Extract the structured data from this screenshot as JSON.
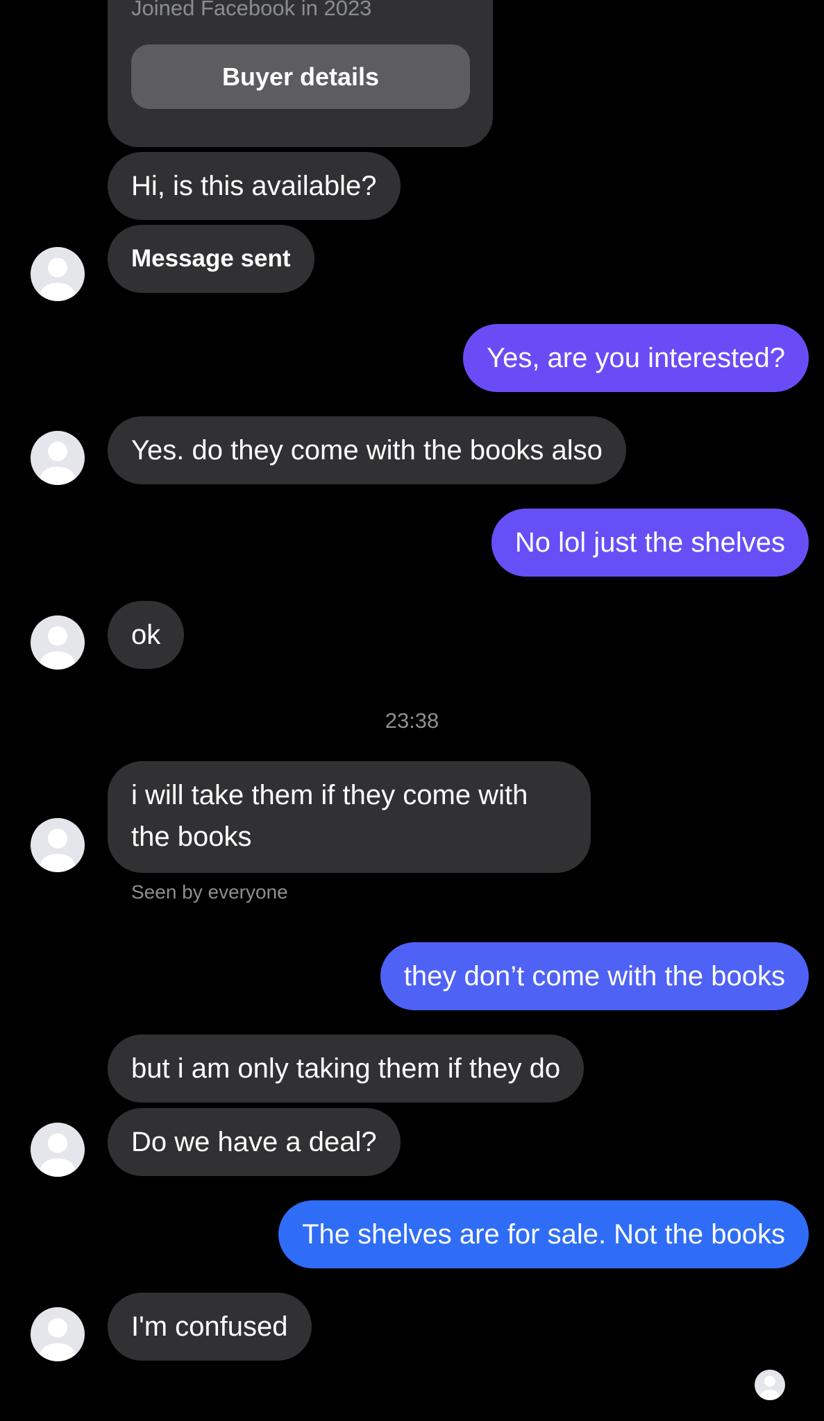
{
  "colors": {
    "background": "#000000",
    "incoming_bubble": "#313133",
    "outgoing_purple": "#6a4cf7",
    "outgoing_indigo": "#5a5ef5",
    "outgoing_blue": "#2f6df6"
  },
  "buyer_card": {
    "joined_text": "Joined Facebook in 2023",
    "button_label": "Buyer details"
  },
  "messages": [
    {
      "side": "in",
      "text": "Hi, is this available?"
    },
    {
      "side": "in",
      "text": "Message sent"
    },
    {
      "side": "out",
      "text": "Yes, are you interested?"
    },
    {
      "side": "in",
      "text": "Yes. do they come with the books also"
    },
    {
      "side": "out",
      "text": "No lol just the shelves"
    },
    {
      "side": "in",
      "text": "ok"
    },
    {
      "side": "in",
      "text": "i will take them if they come with the books"
    },
    {
      "side": "out",
      "text": "they don’t come with the books"
    },
    {
      "side": "in",
      "text": "but i am only taking them if they do"
    },
    {
      "side": "in",
      "text": "Do we have a deal?"
    },
    {
      "side": "out",
      "text": "The shelves are for sale. Not the books"
    },
    {
      "side": "in",
      "text": "I'm confused"
    }
  ],
  "timestamp": "23:38",
  "seen_status": "Seen by everyone",
  "icons": {
    "avatar": "default-profile-avatar-icon",
    "read_receipt": "read-receipt-avatar-icon"
  }
}
